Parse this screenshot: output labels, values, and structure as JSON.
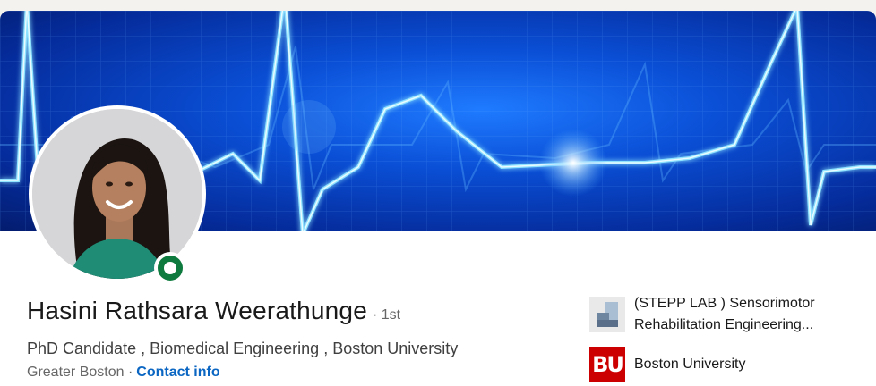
{
  "profile": {
    "name": "Hasini Rathsara Weerathunge",
    "degree": "· 1st",
    "headline": "PhD Candidate , Biomedical Engineering , Boston University",
    "location": "Greater Boston ·",
    "contact_label": "Contact info",
    "online_status": "online"
  },
  "organizations": [
    {
      "name": "(STEPP LAB ) Sensorimotor Rehabilitation Engineering...",
      "logo": "lab-logo"
    },
    {
      "name": "Boston University",
      "logo_text": "BU"
    }
  ],
  "colors": {
    "link": "#0a66c2",
    "status_green": "#0e7a3e",
    "banner_blue": "#0a4fd6",
    "bu_red": "#cc0000"
  },
  "icons": [
    "online-status-icon",
    "stepp-lab-logo-icon",
    "boston-university-logo-icon"
  ]
}
